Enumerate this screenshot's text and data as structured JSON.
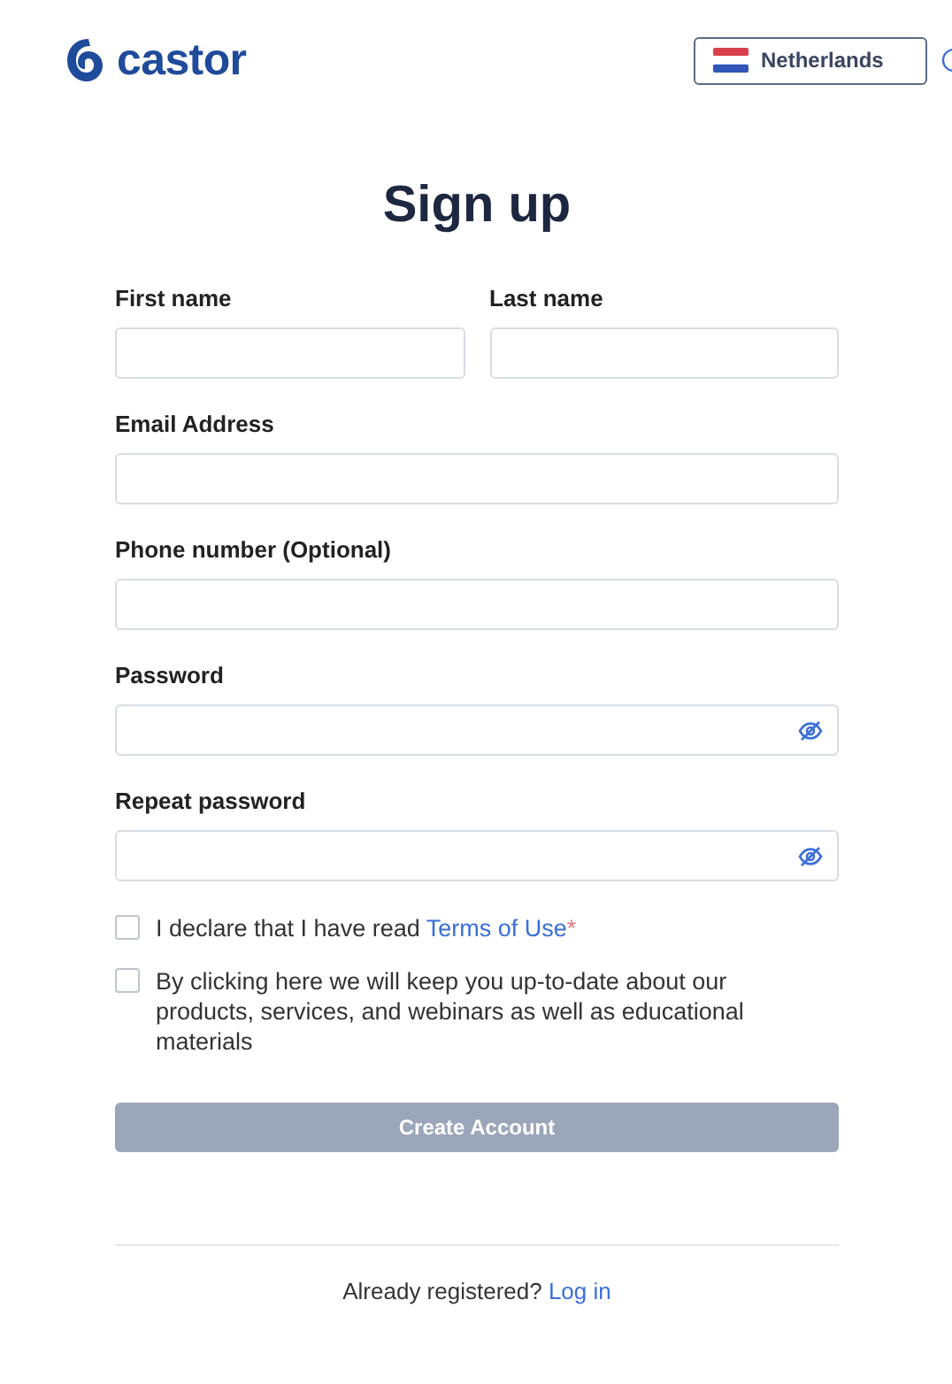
{
  "header": {
    "logo": "castor",
    "country": {
      "label": "Netherlands"
    }
  },
  "title": "Sign up",
  "rows": [
    [
      {
        "label": "First name",
        "kind": "text"
      },
      {
        "label": "Last name",
        "kind": "text"
      }
    ],
    [
      {
        "label": "Email Address",
        "kind": "text"
      }
    ],
    [
      {
        "label": "Phone number (Optional)",
        "kind": "text"
      }
    ],
    [
      {
        "label": "Password",
        "kind": "password"
      }
    ],
    [
      {
        "label": "Repeat password",
        "kind": "password"
      }
    ]
  ],
  "checkboxes": [
    {
      "text": "I declare that I have read ",
      "link": "Terms of Use",
      "required": "*",
      "checked": false
    },
    {
      "text": "By clicking here we will keep you up-to-date about our products, services, and webinars as well as educational materials",
      "checked": false
    }
  ],
  "submit": {
    "label": "Create Account",
    "disabled": true
  },
  "footer": {
    "text": "Already registered?",
    "link": "Log in"
  }
}
